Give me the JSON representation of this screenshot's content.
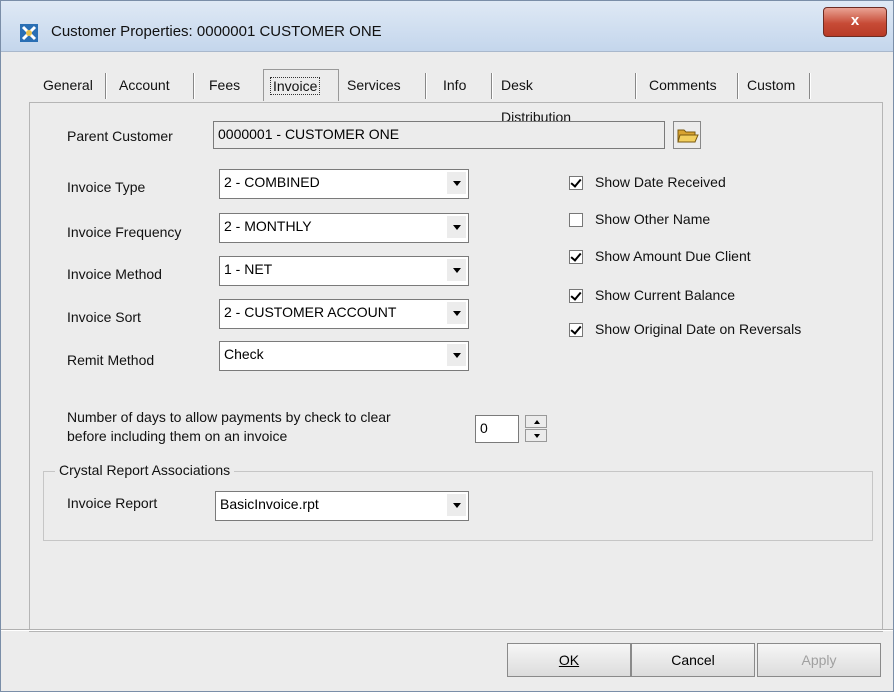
{
  "window": {
    "title": "Customer Properties: 0000001 CUSTOMER ONE",
    "close_label": "x"
  },
  "tabs": [
    "General",
    "Account",
    "Fees",
    "Invoice",
    "Services",
    "Info",
    "Desk Distribution",
    "Comments",
    "Custom"
  ],
  "active_tab": "Invoice",
  "form": {
    "parent_customer": {
      "label": "Parent Customer",
      "value": "0000001 - CUSTOMER ONE"
    },
    "invoice_type": {
      "label": "Invoice Type",
      "value": "2 - COMBINED"
    },
    "invoice_frequency": {
      "label": "Invoice Frequency",
      "value": "2 - MONTHLY"
    },
    "invoice_method": {
      "label": "Invoice Method",
      "value": "1 - NET"
    },
    "invoice_sort": {
      "label": "Invoice Sort",
      "value": "2 - CUSTOMER ACCOUNT"
    },
    "remit_method": {
      "label": "Remit Method",
      "value": "Check"
    },
    "days_clear": {
      "label_line1": "Number of days to allow payments by check to clear",
      "label_line2": "before including them on an invoice",
      "value": "0"
    }
  },
  "checkboxes": [
    {
      "label": "Show Date Received",
      "checked": true
    },
    {
      "label": "Show Other Name",
      "checked": false
    },
    {
      "label": "Show Amount Due Client",
      "checked": true
    },
    {
      "label": "Show Current Balance",
      "checked": true
    },
    {
      "label": "Show Original Date on Reversals",
      "checked": true
    }
  ],
  "crystal": {
    "group_title": "Crystal Report Associations",
    "invoice_report_label": "Invoice Report",
    "invoice_report_value": "BasicInvoice.rpt"
  },
  "buttons": {
    "ok": "OK",
    "cancel": "Cancel",
    "apply": "Apply"
  },
  "colors": {
    "close_button": "#c74b36",
    "titlebar": "#c4d6ec"
  }
}
